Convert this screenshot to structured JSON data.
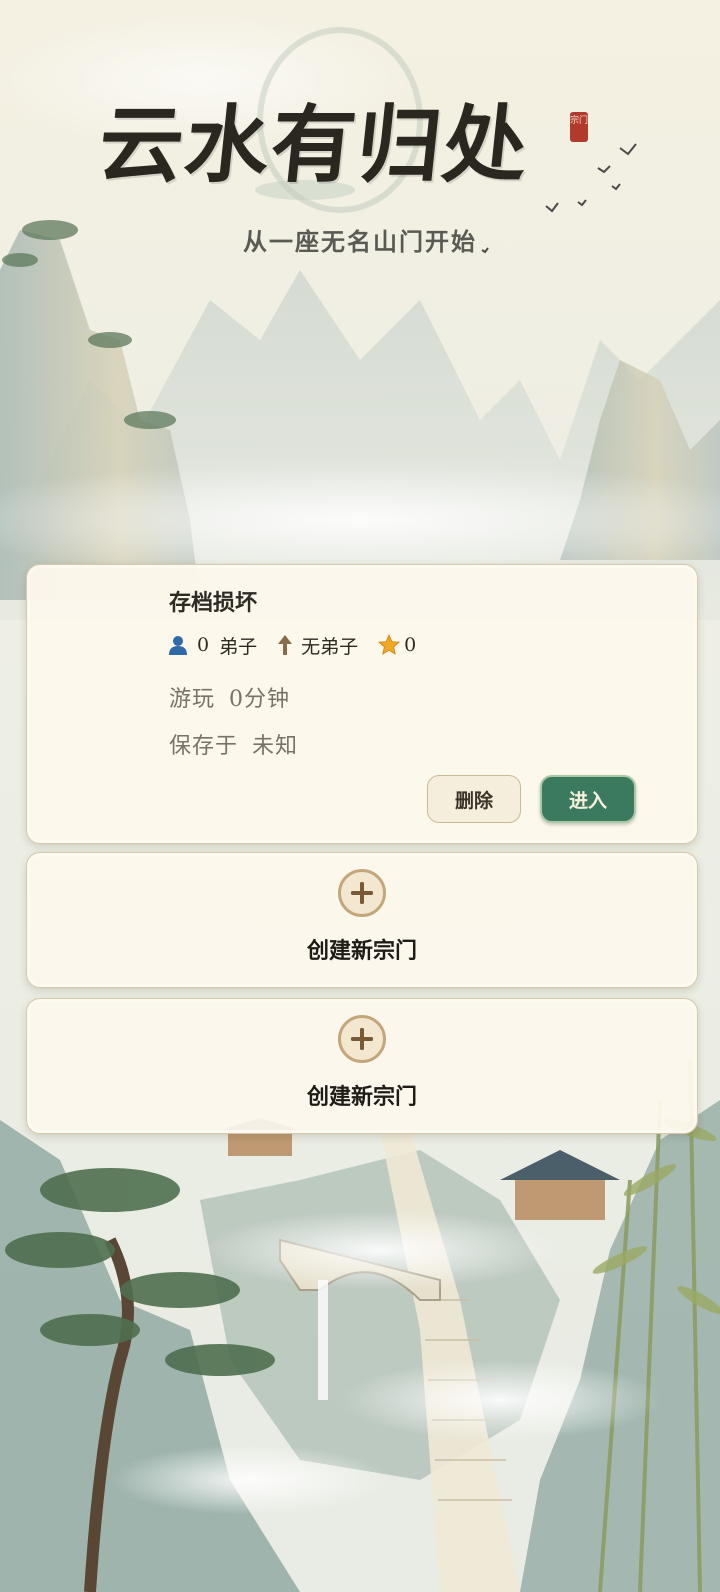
{
  "header": {
    "title": "云水有归处",
    "seal_text": "宗门",
    "subtitle": "从一座无名山门开始"
  },
  "save_slot": {
    "name": "存档损坏",
    "disciple_count": "0",
    "disciple_label": "弟子",
    "rank_label": "无弟子",
    "star_count": "0",
    "playtime_label": "游玩",
    "playtime_value": "0分钟",
    "saved_label": "保存于",
    "saved_value": "未知",
    "delete_label": "删除",
    "enter_label": "进入"
  },
  "empty_slots": [
    {
      "label": "创建新宗门"
    },
    {
      "label": "创建新宗门"
    }
  ],
  "colors": {
    "enter_button": "#3b7a5e",
    "card_background": "#fdf8ec",
    "seal": "#b23a2c"
  },
  "icons": [
    "person-icon",
    "up-arrow-icon",
    "star-icon",
    "plus-icon"
  ]
}
